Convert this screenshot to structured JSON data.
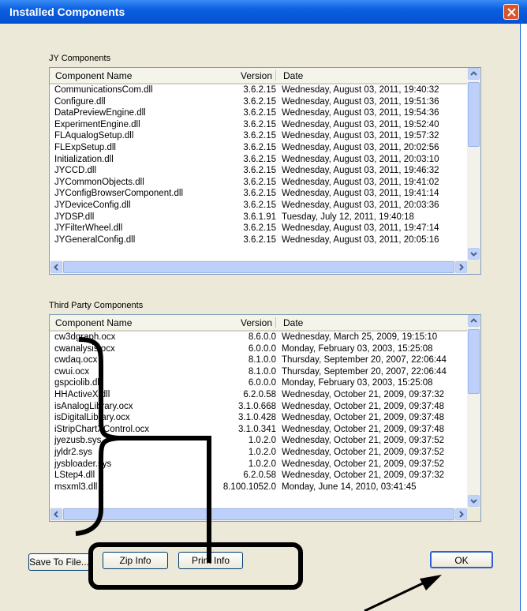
{
  "window": {
    "title": "Installed Components"
  },
  "jy": {
    "label": "JY Components",
    "headers": {
      "name": "Component Name",
      "version": "Version",
      "date": "Date"
    },
    "rows": [
      [
        "CommunicationsCom.dll",
        "3.6.2.15",
        "Wednesday, August 03, 2011,  19:40:32"
      ],
      [
        "Configure.dll",
        "3.6.2.15",
        "Wednesday, August 03, 2011,  19:51:36"
      ],
      [
        "DataPreviewEngine.dll",
        "3.6.2.15",
        "Wednesday, August 03, 2011,  19:54:36"
      ],
      [
        "ExperimentEngine.dll",
        "3.6.2.15",
        "Wednesday, August 03, 2011,  19:52:40"
      ],
      [
        "FLAqualogSetup.dll",
        "3.6.2.15",
        "Wednesday, August 03, 2011,  19:57:32"
      ],
      [
        "FLExpSetup.dll",
        "3.6.2.15",
        "Wednesday, August 03, 2011,  20:02:56"
      ],
      [
        "Initialization.dll",
        "3.6.2.15",
        "Wednesday, August 03, 2011,  20:03:10"
      ],
      [
        "JYCCD.dll",
        "3.6.2.15",
        "Wednesday, August 03, 2011,  19:46:32"
      ],
      [
        "JYCommonObjects.dll",
        "3.6.2.15",
        "Wednesday, August 03, 2011,  19:41:02"
      ],
      [
        "JYConfigBrowserComponent.dll",
        "3.6.2.15",
        "Wednesday, August 03, 2011,  19:41:14"
      ],
      [
        "JYDeviceConfig.dll",
        "3.6.2.15",
        "Wednesday, August 03, 2011,  20:03:36"
      ],
      [
        "JYDSP.dll",
        "3.6.1.91",
        "Tuesday, July 12, 2011,  19:40:18"
      ],
      [
        "JYFilterWheel.dll",
        "3.6.2.15",
        "Wednesday, August 03, 2011,  19:47:14"
      ],
      [
        "JYGeneralConfig.dll",
        "3.6.2.15",
        "Wednesday, August 03, 2011,  20:05:16"
      ]
    ]
  },
  "third": {
    "label": "Third Party Components",
    "headers": {
      "name": "Component Name",
      "version": "Version",
      "date": "Date"
    },
    "rows": [
      [
        "cw3dgraph.ocx",
        "8.6.0.0",
        "Wednesday, March 25, 2009,  19:15:10"
      ],
      [
        "cwanalysis.ocx",
        "6.0.0.0",
        "Monday, February 03, 2003,  15:25:08"
      ],
      [
        "cwdaq.ocx",
        "8.1.0.0",
        "Thursday, September 20, 2007,  22:06:44"
      ],
      [
        "cwui.ocx",
        "8.1.0.0",
        "Thursday, September 20, 2007,  22:06:44"
      ],
      [
        "gspciolib.dll",
        "6.0.0.0",
        "Monday, February 03, 2003,  15:25:08"
      ],
      [
        "HHActiveX.dll",
        "6.2.0.58",
        "Wednesday, October 21, 2009,  09:37:32"
      ],
      [
        "isAnalogLibrary.ocx",
        "3.1.0.668",
        "Wednesday, October 21, 2009,  09:37:48"
      ],
      [
        "isDigitalLibrary.ocx",
        "3.1.0.428",
        "Wednesday, October 21, 2009,  09:37:48"
      ],
      [
        "iStripChartXControl.ocx",
        "3.1.0.341",
        "Wednesday, October 21, 2009,  09:37:48"
      ],
      [
        "jyezusb.sys",
        "1.0.2.0",
        "Wednesday, October 21, 2009,  09:37:52"
      ],
      [
        "jyldr2.sys",
        "1.0.2.0",
        "Wednesday, October 21, 2009,  09:37:52"
      ],
      [
        "jysbloader.sys",
        "1.0.2.0",
        "Wednesday, October 21, 2009,  09:37:52"
      ],
      [
        "LStep4.dll",
        "6.2.0.58",
        "Wednesday, October 21, 2009,  09:37:32"
      ],
      [
        "msxml3.dll",
        "8.100.1052.0",
        "Monday, June 14, 2010,  03:41:45"
      ]
    ]
  },
  "buttons": {
    "save": "Save To File...",
    "zip": "Zip Info",
    "print": "Print Info",
    "ok": "OK"
  }
}
